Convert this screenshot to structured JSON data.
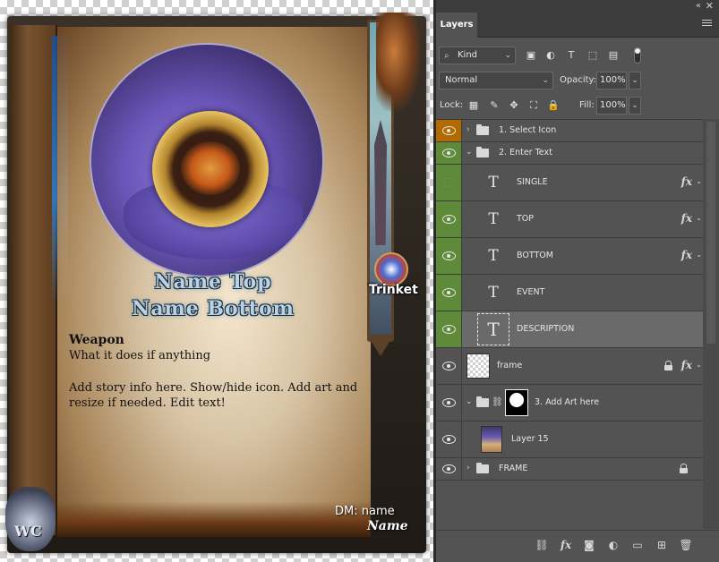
{
  "canvas": {
    "card": {
      "name_top": "Name Top",
      "name_bottom": "Name Bottom",
      "item_type": "Weapon",
      "effect_text": "What it does if anything",
      "story_text": "Add story info here. Show/hide icon. Add art and resize if needed. Edit text!",
      "category_label": "Trinket",
      "dm_label": "DM:   name",
      "dm_name": "Name",
      "logo_text": "WC"
    }
  },
  "panel": {
    "tab_label": "Layers",
    "collapse_glyph": "«",
    "close_glyph": "✕",
    "filter_kind": "Kind",
    "blend_mode": "Normal",
    "opacity_label": "Opacity:",
    "opacity_value": "100%",
    "lock_label": "Lock:",
    "fill_label": "Fill:",
    "fill_value": "100%",
    "layers": [
      {
        "name": "1. Select Icon",
        "eye_color": "#b36b00",
        "kind": "group"
      },
      {
        "name": "2. Enter Text",
        "eye_color": "#5f8a3a",
        "kind": "group"
      },
      {
        "name": "SINGLE",
        "eye_color": "#5f8a3a",
        "kind": "text",
        "hidden": true,
        "fx": "fx"
      },
      {
        "name": "TOP",
        "eye_color": "#5f8a3a",
        "kind": "text",
        "fx": "fx"
      },
      {
        "name": "BOTTOM",
        "eye_color": "#5f8a3a",
        "kind": "text",
        "fx": "fx"
      },
      {
        "name": "EVENT",
        "eye_color": "#5f8a3a",
        "kind": "text"
      },
      {
        "name": "DESCRIPTION",
        "eye_color": "#5f8a3a",
        "kind": "text",
        "selected": true
      },
      {
        "name": "frame",
        "kind": "pixel",
        "locked": true,
        "fx": "fx"
      },
      {
        "name": "3. Add Art here",
        "kind": "group-masked"
      },
      {
        "name": "Layer 15",
        "kind": "pixel-art"
      },
      {
        "name": "FRAME",
        "kind": "group",
        "locked": true
      }
    ],
    "glyphs": {
      "chevron_right": "›",
      "chevron_down": "⌄",
      "type": "T",
      "fx_caret": "⌄",
      "link": "🔗"
    }
  },
  "colors": {
    "panel_bg": "#535353",
    "eye_orange": "#b36b00",
    "eye_green": "#5f8a3a",
    "selected_row": "#6a6a6a"
  }
}
